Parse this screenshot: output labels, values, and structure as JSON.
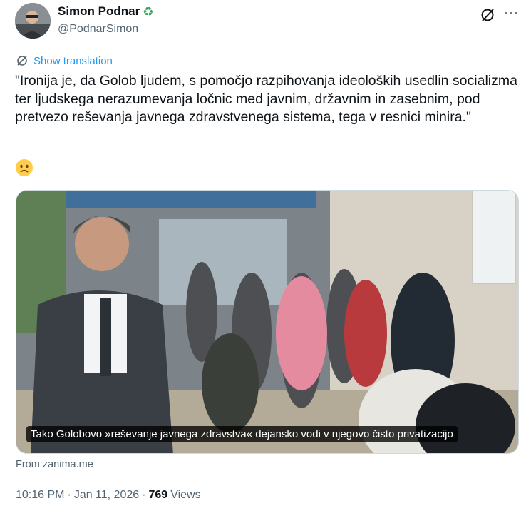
{
  "author": {
    "display_name": "Simon Podnar",
    "handle": "@PodnarSimon",
    "badge_icon": "recycle-icon"
  },
  "header_actions": {
    "grok_icon": "grok-icon",
    "more_icon": "more-icon",
    "more_glyph": "···"
  },
  "translation": {
    "label": "Show translation",
    "icon": "translate-icon"
  },
  "tweet": {
    "text": "\"Ironija je, da Golob ljudem, s pomočjo razpihovanja ideoloških usedlin socializma ter ljudskega nerazumevanja ločnic med javnim, državnim in zasebnim, pod pretvezo reševanja javnega zdravstvenega sistema, tega v resnici minira.\"",
    "emoji": "slightly-frowning-face"
  },
  "media": {
    "caption": "Tako Golobovo »reševanje javnega zdravstva« dejansko vodi v njegovo čisto privatizacijo",
    "source": "From zanima.me"
  },
  "meta": {
    "time": "10:16 PM",
    "separator": "·",
    "date": "Jan 11, 2026",
    "separator2": "·",
    "views_count": "769",
    "views_label": "Views"
  },
  "colors": {
    "link": "#1d9bf0",
    "secondary_text": "#536471",
    "primary_text": "#0f1419"
  }
}
